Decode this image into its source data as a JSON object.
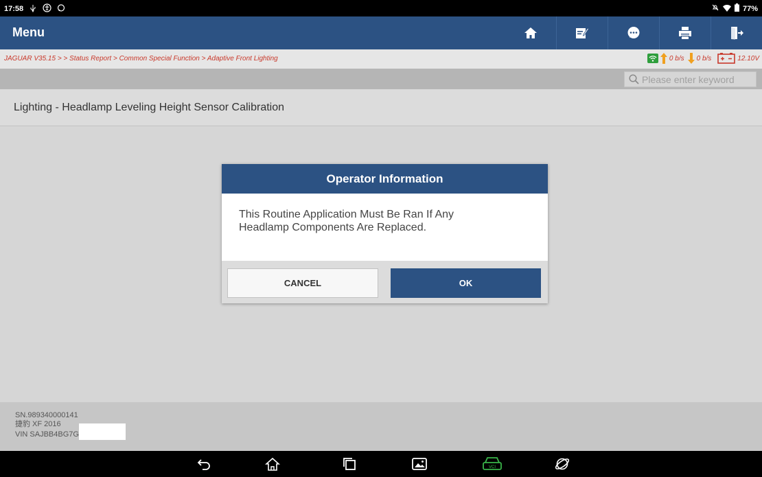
{
  "status_bar": {
    "time": "17:58",
    "battery": "77%",
    "left_icons": [
      "usb-icon",
      "accessibility-icon",
      "chat-icon"
    ],
    "right_icons": [
      "mute-icon",
      "wifi-icon",
      "battery-icon"
    ]
  },
  "header": {
    "title": "Menu",
    "buttons": [
      "home-icon",
      "edit-icon",
      "message-icon",
      "print-icon",
      "exit-icon"
    ]
  },
  "breadcrumb": "JAGUAR V35.15 > > Status Report > Common Special Function > Adaptive Front Lighting",
  "network": {
    "upload": "0 b/s",
    "download": "0 b/s",
    "voltage": "12.10V"
  },
  "search": {
    "placeholder": "Please enter keyword"
  },
  "function_title": "Lighting - Headlamp Leveling Height Sensor Calibration",
  "dialog": {
    "title": "Operator Information",
    "message_line1": "This Routine Application Must Be Ran If Any",
    "message_line2": "Headlamp Components Are Replaced.",
    "cancel_label": "CANCEL",
    "ok_label": "OK"
  },
  "footer": {
    "sn": "SN.989340000141",
    "vehicle": "捷豹 XF 2016",
    "vin": "VIN SAJBB4BG7G"
  },
  "nav_bar": [
    "back-icon",
    "home-icon",
    "recents-icon",
    "screenshot-icon",
    "vci-icon",
    "browser-icon"
  ],
  "colors": {
    "header_blue": "#2c5283",
    "breadcrumb_red": "#c9382a",
    "signal_green": "#2e9e3c",
    "arrow_orange": "#f0a020",
    "vci_green": "#3ab54a"
  }
}
